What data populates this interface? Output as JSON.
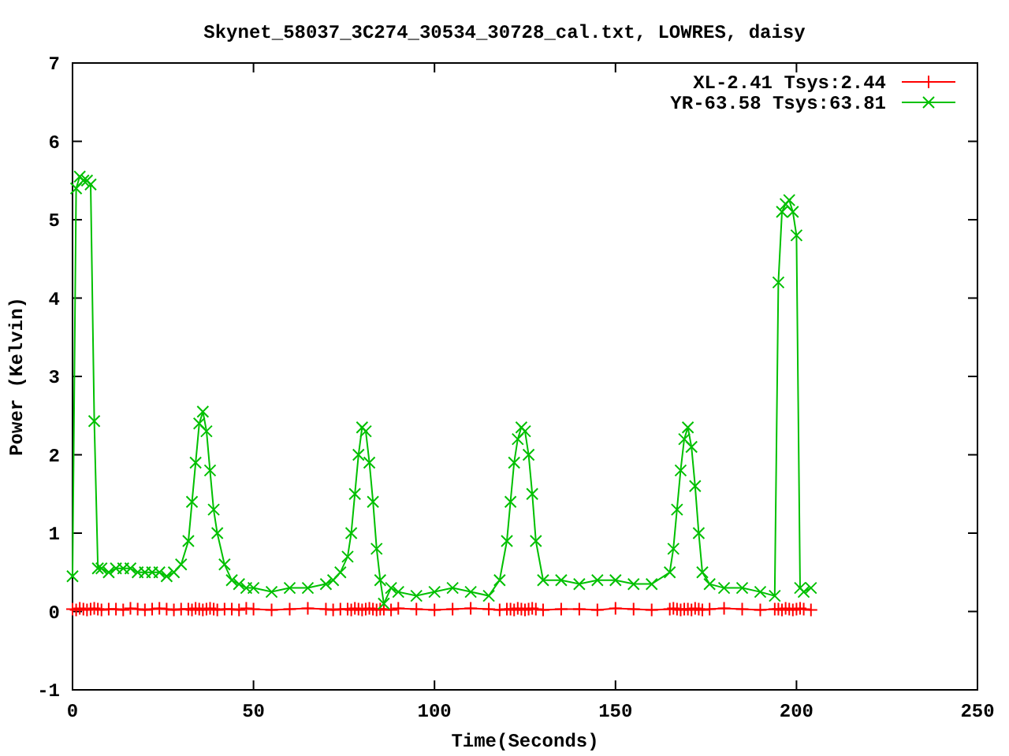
{
  "chart_data": {
    "type": "line",
    "title": "Skynet_58037_3C274_30534_30728_cal.txt, LOWRES, daisy",
    "xlabel": "Time(Seconds)",
    "ylabel": "Power (Kelvin)",
    "legend": true,
    "xlim": [
      0,
      250
    ],
    "ylim": [
      -1,
      7
    ],
    "xticks": [
      0,
      50,
      100,
      150,
      200,
      250
    ],
    "yticks": [
      -1,
      0,
      1,
      2,
      3,
      4,
      5,
      6,
      7
    ],
    "x": [
      0,
      1,
      2,
      3,
      4,
      5,
      6,
      7,
      8,
      10,
      12,
      14,
      16,
      18,
      20,
      22,
      24,
      26,
      28,
      30,
      32,
      33,
      34,
      35,
      36,
      37,
      38,
      39,
      40,
      42,
      44,
      46,
      48,
      50,
      55,
      60,
      65,
      70,
      72,
      74,
      76,
      77,
      78,
      79,
      80,
      81,
      82,
      83,
      84,
      85,
      86,
      88,
      90,
      95,
      100,
      105,
      110,
      115,
      118,
      120,
      121,
      122,
      123,
      124,
      125,
      126,
      127,
      128,
      130,
      135,
      140,
      145,
      150,
      155,
      160,
      165,
      166,
      167,
      168,
      169,
      170,
      171,
      172,
      173,
      174,
      176,
      180,
      185,
      190,
      194,
      195,
      196,
      197,
      198,
      199,
      200,
      201,
      202,
      204
    ],
    "series": [
      {
        "name": "XL-2.41 Tsys:2.44",
        "color": "#ff0000",
        "marker": "plus",
        "values": [
          0.03,
          0.02,
          0.04,
          0.03,
          0.02,
          0.03,
          0.04,
          0.03,
          0.02,
          0.03,
          0.03,
          0.02,
          0.04,
          0.03,
          0.02,
          0.03,
          0.04,
          0.03,
          0.02,
          0.03,
          0.03,
          0.02,
          0.04,
          0.03,
          0.02,
          0.03,
          0.04,
          0.03,
          0.02,
          0.03,
          0.03,
          0.02,
          0.04,
          0.03,
          0.02,
          0.03,
          0.04,
          0.03,
          0.02,
          0.03,
          0.03,
          0.02,
          0.04,
          0.03,
          0.02,
          0.03,
          0.04,
          0.03,
          0.02,
          0.03,
          0.03,
          0.02,
          0.04,
          0.03,
          0.02,
          0.03,
          0.04,
          0.03,
          0.02,
          0.03,
          0.03,
          0.02,
          0.04,
          0.03,
          0.02,
          0.03,
          0.04,
          0.03,
          0.02,
          0.03,
          0.03,
          0.02,
          0.04,
          0.03,
          0.02,
          0.03,
          0.04,
          0.03,
          0.02,
          0.03,
          0.03,
          0.02,
          0.04,
          0.03,
          0.02,
          0.03,
          0.04,
          0.03,
          0.02,
          0.03,
          0.03,
          0.02,
          0.04,
          0.03,
          0.02,
          0.03,
          0.04,
          0.03,
          0.02
        ]
      },
      {
        "name": "YR-63.58 Tsys:63.81",
        "color": "#00c000",
        "marker": "cross",
        "values": [
          0.45,
          5.4,
          5.55,
          5.5,
          5.5,
          5.45,
          2.43,
          0.55,
          0.55,
          0.5,
          0.55,
          0.55,
          0.55,
          0.5,
          0.5,
          0.5,
          0.5,
          0.45,
          0.5,
          0.6,
          0.9,
          1.4,
          1.9,
          2.4,
          2.55,
          2.3,
          1.8,
          1.3,
          1.0,
          0.6,
          0.4,
          0.35,
          0.3,
          0.3,
          0.25,
          0.3,
          0.3,
          0.35,
          0.4,
          0.5,
          0.7,
          1.0,
          1.5,
          2.0,
          2.35,
          2.3,
          1.9,
          1.4,
          0.8,
          0.4,
          0.1,
          0.3,
          0.25,
          0.2,
          0.25,
          0.3,
          0.25,
          0.2,
          0.4,
          0.9,
          1.4,
          1.9,
          2.2,
          2.35,
          2.3,
          2.0,
          1.5,
          0.9,
          0.4,
          0.4,
          0.35,
          0.4,
          0.4,
          0.35,
          0.35,
          0.5,
          0.8,
          1.3,
          1.8,
          2.2,
          2.35,
          2.1,
          1.6,
          1.0,
          0.5,
          0.35,
          0.3,
          0.3,
          0.25,
          0.2,
          4.2,
          5.1,
          5.2,
          5.25,
          5.1,
          4.8,
          0.3,
          0.25,
          0.3
        ]
      }
    ]
  }
}
